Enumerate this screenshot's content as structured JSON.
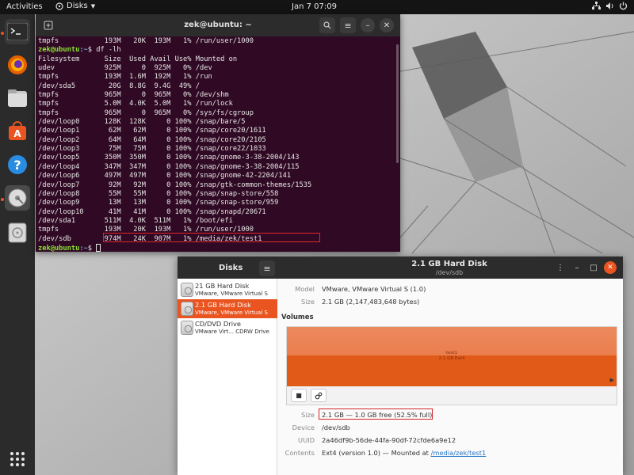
{
  "topbar": {
    "activities": "Activities",
    "app_menu": "Disks",
    "clock": "Jan 7  07:09"
  },
  "dock": {
    "items": [
      {
        "name": "terminal",
        "running": true
      },
      {
        "name": "firefox",
        "running": false
      },
      {
        "name": "files",
        "running": false
      },
      {
        "name": "software",
        "running": false
      },
      {
        "name": "help",
        "running": false
      },
      {
        "name": "disks",
        "running": true
      },
      {
        "name": "disk-image",
        "running": false
      }
    ],
    "show_apps": "show-apps-icon"
  },
  "terminal": {
    "title": "zek@ubuntu: ~",
    "lines": [
      {
        "type": "out",
        "text": "tmpfs           193M   20K  193M   1% /run/user/1000"
      },
      {
        "type": "prompt",
        "user": "zek@ubuntu",
        "path": ":~",
        "cmd": "$ df -lh"
      },
      {
        "type": "out",
        "text": "Filesystem      Size  Used Avail Use% Mounted on"
      },
      {
        "type": "out",
        "text": "udev            925M     0  925M   0% /dev"
      },
      {
        "type": "out",
        "text": "tmpfs           193M  1.6M  192M   1% /run"
      },
      {
        "type": "out",
        "text": "/dev/sda5        20G  8.8G  9.4G  49% /"
      },
      {
        "type": "out",
        "text": "tmpfs           965M     0  965M   0% /dev/shm"
      },
      {
        "type": "out",
        "text": "tmpfs           5.0M  4.0K  5.0M   1% /run/lock"
      },
      {
        "type": "out",
        "text": "tmpfs           965M     0  965M   0% /sys/fs/cgroup"
      },
      {
        "type": "out",
        "text": "/dev/loop0      128K  128K     0 100% /snap/bare/5"
      },
      {
        "type": "out",
        "text": "/dev/loop1       62M   62M     0 100% /snap/core20/1611"
      },
      {
        "type": "out",
        "text": "/dev/loop2       64M   64M     0 100% /snap/core20/2105"
      },
      {
        "type": "out",
        "text": "/dev/loop3       75M   75M     0 100% /snap/core22/1033"
      },
      {
        "type": "out",
        "text": "/dev/loop5      350M  350M     0 100% /snap/gnome-3-38-2004/143"
      },
      {
        "type": "out",
        "text": "/dev/loop4      347M  347M     0 100% /snap/gnome-3-38-2004/115"
      },
      {
        "type": "out",
        "text": "/dev/loop6      497M  497M     0 100% /snap/gnome-42-2204/141"
      },
      {
        "type": "out",
        "text": "/dev/loop7       92M   92M     0 100% /snap/gtk-common-themes/1535"
      },
      {
        "type": "out",
        "text": "/dev/loop8       55M   55M     0 100% /snap/snap-store/558"
      },
      {
        "type": "out",
        "text": "/dev/loop9       13M   13M     0 100% /snap/snap-store/959"
      },
      {
        "type": "out",
        "text": "/dev/loop10      41M   41M     0 100% /snap/snapd/20671"
      },
      {
        "type": "out",
        "text": "/dev/sda1       511M  4.0K  511M   1% /boot/efi"
      },
      {
        "type": "out",
        "text": "tmpfs           193M   20K  193M   1% /run/user/1000"
      },
      {
        "type": "out",
        "text": "/dev/sdb        974M   24K  907M   1% /media/zek/test1"
      },
      {
        "type": "prompt",
        "user": "zek@ubuntu",
        "path": ":~",
        "cmd": "$ "
      }
    ]
  },
  "disks": {
    "app_title": "Disks",
    "window_title": "2.1 GB Hard Disk",
    "window_subtitle": "/dev/sdb",
    "devices": [
      {
        "name": "21 GB Hard Disk",
        "model": "VMware, VMware Virtual S",
        "selected": false
      },
      {
        "name": "2.1 GB Hard Disk",
        "model": "VMware, VMware Virtual S",
        "selected": true
      },
      {
        "name": "CD/DVD Drive",
        "model": "VMware Virt...  CDRW Drive",
        "selected": false
      }
    ],
    "model_label": "Model",
    "model_value": "VMware, VMware Virtual S (1.0)",
    "size_label": "Size",
    "size_value": "2.1 GB (2,147,483,648 bytes)",
    "volumes_heading": "Volumes",
    "volume_name": "test1",
    "volume_desc": "2.1 GB Ext4",
    "partition": {
      "size_label": "Size",
      "size_value": "2.1 GB — 1.0 GB free (52.5% full)",
      "device_label": "Device",
      "device_value": "/dev/sdb",
      "uuid_label": "UUID",
      "uuid_value": "2a46df9b-56de-44fa-90df-72cfde6a9e12",
      "contents_label": "Contents",
      "contents_prefix": "Ext4 (version 1.0) — Mounted at ",
      "contents_link": "/media/zek/test1"
    }
  },
  "colors": {
    "accent": "#e95420",
    "terminal_bg": "#300a24",
    "highlight": "#e4232b"
  }
}
